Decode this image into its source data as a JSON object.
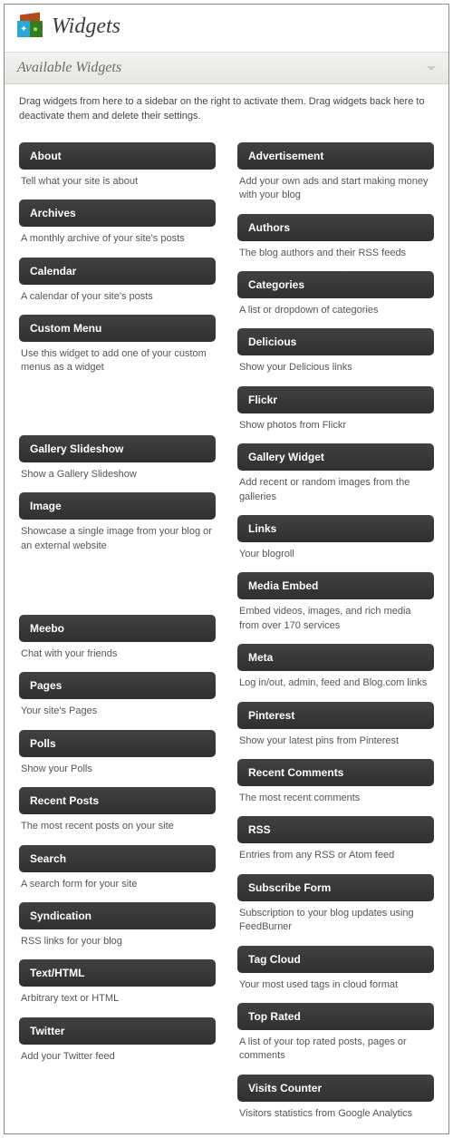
{
  "page_title": "Widgets",
  "section_title": "Available Widgets",
  "intro": "Drag widgets from here to a sidebar on the right to activate them. Drag widgets back here to deactivate them and delete their settings.",
  "left": [
    {
      "title": "About",
      "desc": "Tell what your site is about"
    },
    {
      "title": "Archives",
      "desc": "A monthly archive of your site's posts"
    },
    {
      "title": "Calendar",
      "desc": "A calendar of your site's posts"
    },
    {
      "title": "Custom Menu",
      "desc": "Use this widget to add one of your custom menus as a widget"
    },
    {
      "title": "Gallery Slideshow",
      "desc": "Show a Gallery Slideshow"
    },
    {
      "title": "Image",
      "desc": "Showcase a single image from your blog or an external website"
    },
    {
      "title": "Meebo",
      "desc": "Chat with your friends"
    },
    {
      "title": "Pages",
      "desc": "Your site's Pages"
    },
    {
      "title": "Polls",
      "desc": "Show your Polls"
    },
    {
      "title": "Recent Posts",
      "desc": "The most recent posts on your site"
    },
    {
      "title": "Search",
      "desc": "A search form for your site"
    },
    {
      "title": "Syndication",
      "desc": "RSS links for your blog"
    },
    {
      "title": "Text/HTML",
      "desc": "Arbitrary text or HTML"
    },
    {
      "title": "Twitter",
      "desc": "Add your Twitter feed"
    }
  ],
  "right": [
    {
      "title": "Advertisement",
      "desc": "Add your own ads and start making money with your blog"
    },
    {
      "title": "Authors",
      "desc": "The blog authors and their RSS feeds"
    },
    {
      "title": "Categories",
      "desc": "A list or dropdown of categories"
    },
    {
      "title": "Delicious",
      "desc": "Show your Delicious links"
    },
    {
      "title": "Flickr",
      "desc": "Show photos from Flickr"
    },
    {
      "title": "Gallery Widget",
      "desc": "Add recent or random images from the galleries"
    },
    {
      "title": "Links",
      "desc": "Your blogroll"
    },
    {
      "title": "Media Embed",
      "desc": "Embed videos, images, and rich media from over 170 services"
    },
    {
      "title": "Meta",
      "desc": "Log in/out, admin, feed and Blog.com links"
    },
    {
      "title": "Pinterest",
      "desc": "Show your latest pins from Pinterest"
    },
    {
      "title": "Recent Comments",
      "desc": "The most recent comments"
    },
    {
      "title": "RSS",
      "desc": "Entries from any RSS or Atom feed"
    },
    {
      "title": "Subscribe Form",
      "desc": "Subscription to your blog updates using FeedBurner"
    },
    {
      "title": "Tag Cloud",
      "desc": "Your most used tags in cloud format"
    },
    {
      "title": "Top Rated",
      "desc": "A list of your top rated posts, pages or comments"
    },
    {
      "title": "Visits Counter",
      "desc": "Visitors statistics from Google Analytics"
    }
  ]
}
